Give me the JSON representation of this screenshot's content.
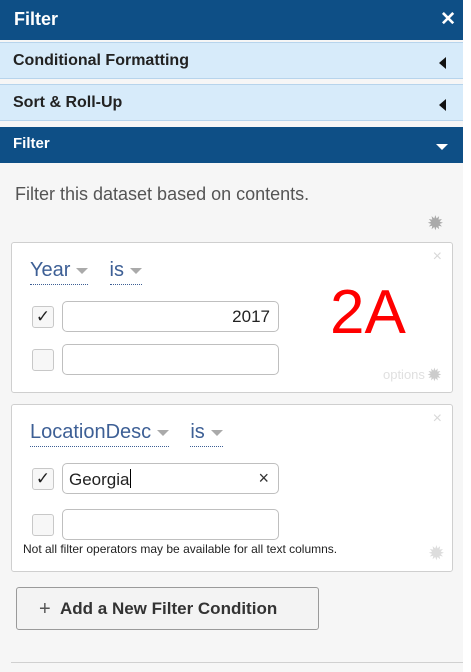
{
  "header": {
    "title": "Filter",
    "close_glyph": "✕"
  },
  "sections": {
    "conditional_formatting": "Conditional Formatting",
    "sort_rollup": "Sort & Roll-Up",
    "filter": "Filter"
  },
  "filter_panel": {
    "description": "Filter this dataset based on contents.",
    "conditions": [
      {
        "column": "Year",
        "operator": "is",
        "values": [
          {
            "checked": true,
            "value": "2017"
          },
          {
            "checked": false,
            "value": ""
          }
        ],
        "options_label": "options"
      },
      {
        "column": "LocationDesc",
        "operator": "is",
        "values": [
          {
            "checked": true,
            "value": "Georgia"
          },
          {
            "checked": false,
            "value": ""
          }
        ],
        "note": "Not all filter operators may be available for all text columns."
      }
    ],
    "add_button": "Add a New Filter Condition",
    "add_glyph": "+"
  },
  "annotation": "2A",
  "icons": {
    "close": "close-icon",
    "collapse": "triangle-left-icon",
    "expand": "triangle-down-icon",
    "gear": "gear-icon",
    "check": "check-icon",
    "clear": "clear-icon"
  },
  "colors": {
    "header_bg": "#0e4f86",
    "section_bg": "#d7ebfa",
    "link_blue": "#3d5f95",
    "annotation_red": "#ff0000"
  },
  "glyphs": {
    "gear": "✹",
    "check": "✓",
    "clear": "×",
    "card_close": "×"
  }
}
